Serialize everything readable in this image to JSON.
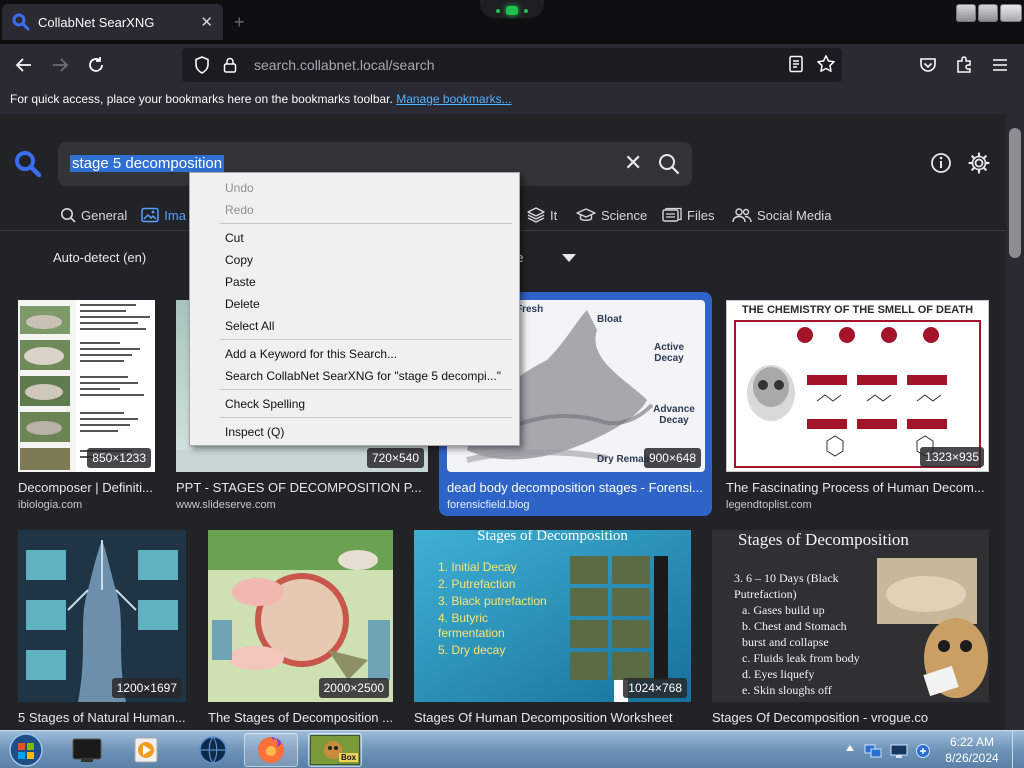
{
  "browser": {
    "tab_title": "CollabNet SearXNG",
    "url_host": "search.collabnet.local",
    "url_path": "/search",
    "bookmarks_msg": "For quick access, place your bookmarks here on the bookmarks toolbar.",
    "bookmarks_link": "Manage bookmarks..."
  },
  "search": {
    "query": "stage 5 decomposition"
  },
  "categories": [
    {
      "label": "General",
      "icon": "search-icon"
    },
    {
      "label": "Ima",
      "icon": "image-icon"
    },
    {
      "label": "It",
      "icon": "layers-icon"
    },
    {
      "label": "Science",
      "icon": "graduation-cap-icon"
    },
    {
      "label": "Files",
      "icon": "files-icon"
    },
    {
      "label": "Social Media",
      "icon": "people-icon"
    }
  ],
  "filters": {
    "language": "Auto-detect (en)",
    "time": "ne"
  },
  "results": [
    {
      "title": "Decomposer | Definiti...",
      "source": "ibiologia.com",
      "res": "850×1233"
    },
    {
      "title": "PPT - STAGES OF DECOMPOSITION P...",
      "source": "www.slideserve.com",
      "res": "720×540"
    },
    {
      "title": "dead body decomposition stages - Forensi...",
      "source": "forensicfield.blog",
      "res": "900×648",
      "labels": [
        "Fresh",
        "Bloat",
        "Active Decay",
        "Advance Decay",
        "Dry Remains"
      ]
    },
    {
      "title": "The Fascinating Process of Human Decom...",
      "source": "legendtoplist.com",
      "res": "1323×935",
      "heading": "THE CHEMISTRY OF THE SMELL OF DEATH"
    },
    {
      "title": "5 Stages of Natural Human...",
      "source": "",
      "res": "1200×1697"
    },
    {
      "title": "The Stages of Decomposition ...",
      "source": "",
      "res": "2000×2500"
    },
    {
      "title": "Stages Of Human Decomposition Worksheet",
      "source": "",
      "res": "1024×768",
      "heading": "Stages of Decomposition",
      "list": [
        "1. Initial Decay",
        "2. Putrefaction",
        "3. Black putrefaction",
        "4. Butyric fermentation",
        "5. Dry decay"
      ]
    },
    {
      "title": "Stages Of Decomposition - vrogue.co",
      "source": "",
      "res": "",
      "heading": "Stages of Decomposition",
      "list": [
        "3. 6 – 10 Days (Black Putrefaction)",
        "a. Gases build up",
        "b. Chest and Stomach burst and collapse",
        "c. Fluids leak from body",
        "d. Eyes liquefy",
        "e. Skin sloughs off"
      ]
    }
  ],
  "context_menu": {
    "undo": "Undo",
    "redo": "Redo",
    "cut": "Cut",
    "copy": "Copy",
    "paste": "Paste",
    "delete": "Delete",
    "select_all": "Select All",
    "add_keyword": "Add a Keyword for this Search...",
    "search_for": "Search CollabNet SearXNG for \"stage 5 decompi...\"",
    "check_spelling": "Check Spelling",
    "inspect": "Inspect (Q)"
  },
  "taskbar": {
    "time": "6:22 AM",
    "date": "8/26/2024",
    "box_label": "Box"
  },
  "colors": {
    "accent": "#5aa0ff",
    "selection": "#2f6fd1",
    "selected_card": "#2e64c8"
  }
}
